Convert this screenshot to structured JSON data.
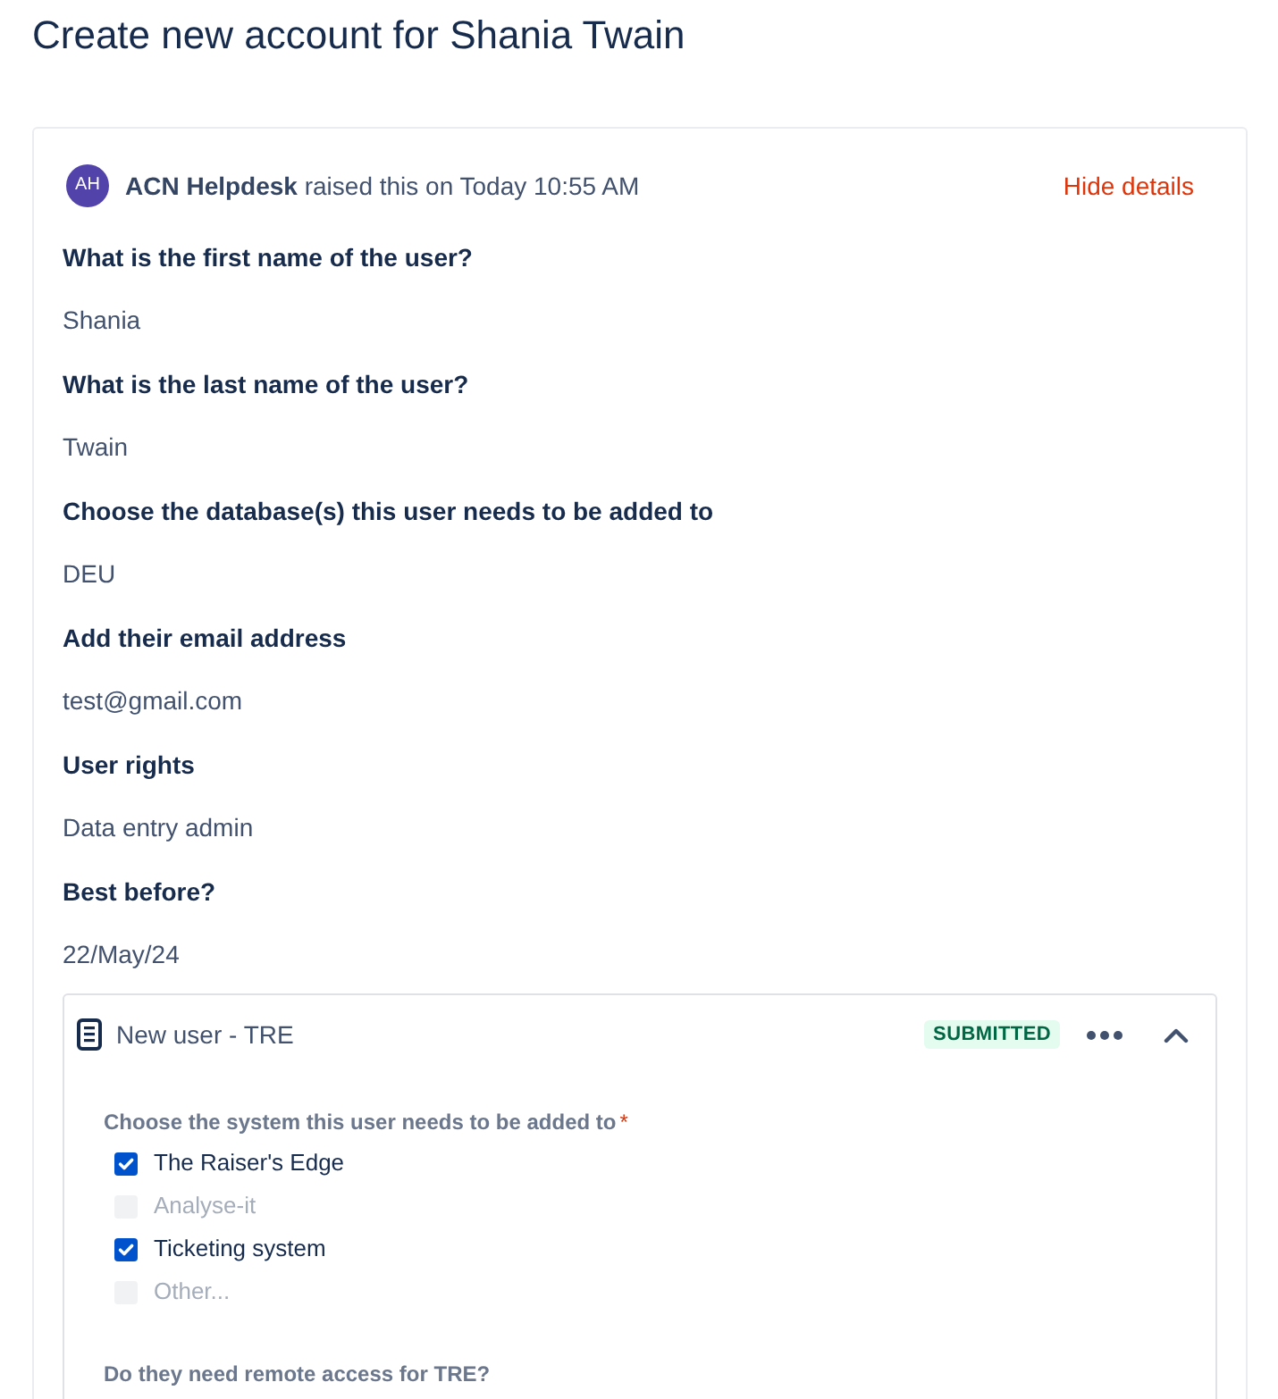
{
  "page": {
    "title": "Create new account for Shania Twain"
  },
  "request": {
    "avatar": {
      "initials": "AH"
    },
    "raised_by": "**ACN Helpdesk** raised this on Today 10:55 AM",
    "toggle_link": "Hide details",
    "fields": [
      {
        "question": "What is the first name of the user?",
        "answer": "Shania"
      },
      {
        "question": "What is the last name of the user?",
        "answer": "Twain"
      },
      {
        "question": "Choose the database(s) this user needs to be added to",
        "answer": "DEU"
      },
      {
        "question": "Add their email address",
        "answer": "test@gmail.com"
      },
      {
        "question": "User rights",
        "answer": "Data entry admin"
      },
      {
        "question": "Best before?",
        "answer": "22/May/24"
      }
    ]
  },
  "form": {
    "title": "New user - TRE",
    "status": "SUBMITTED",
    "expanded": true,
    "questions": [
      {
        "kind": "checkbox_group",
        "label": "Choose the system this user needs to be added to",
        "required_mark": "*",
        "options": [
          {
            "label": "The Raiser's Edge",
            "checked": true
          },
          {
            "label": "Analyse-it",
            "checked": false
          },
          {
            "label": "Ticketing system",
            "checked": true
          },
          {
            "label": "Other...",
            "checked": false
          }
        ]
      },
      {
        "kind": "text",
        "label": "Do they need remote access for TRE?"
      }
    ]
  }
}
